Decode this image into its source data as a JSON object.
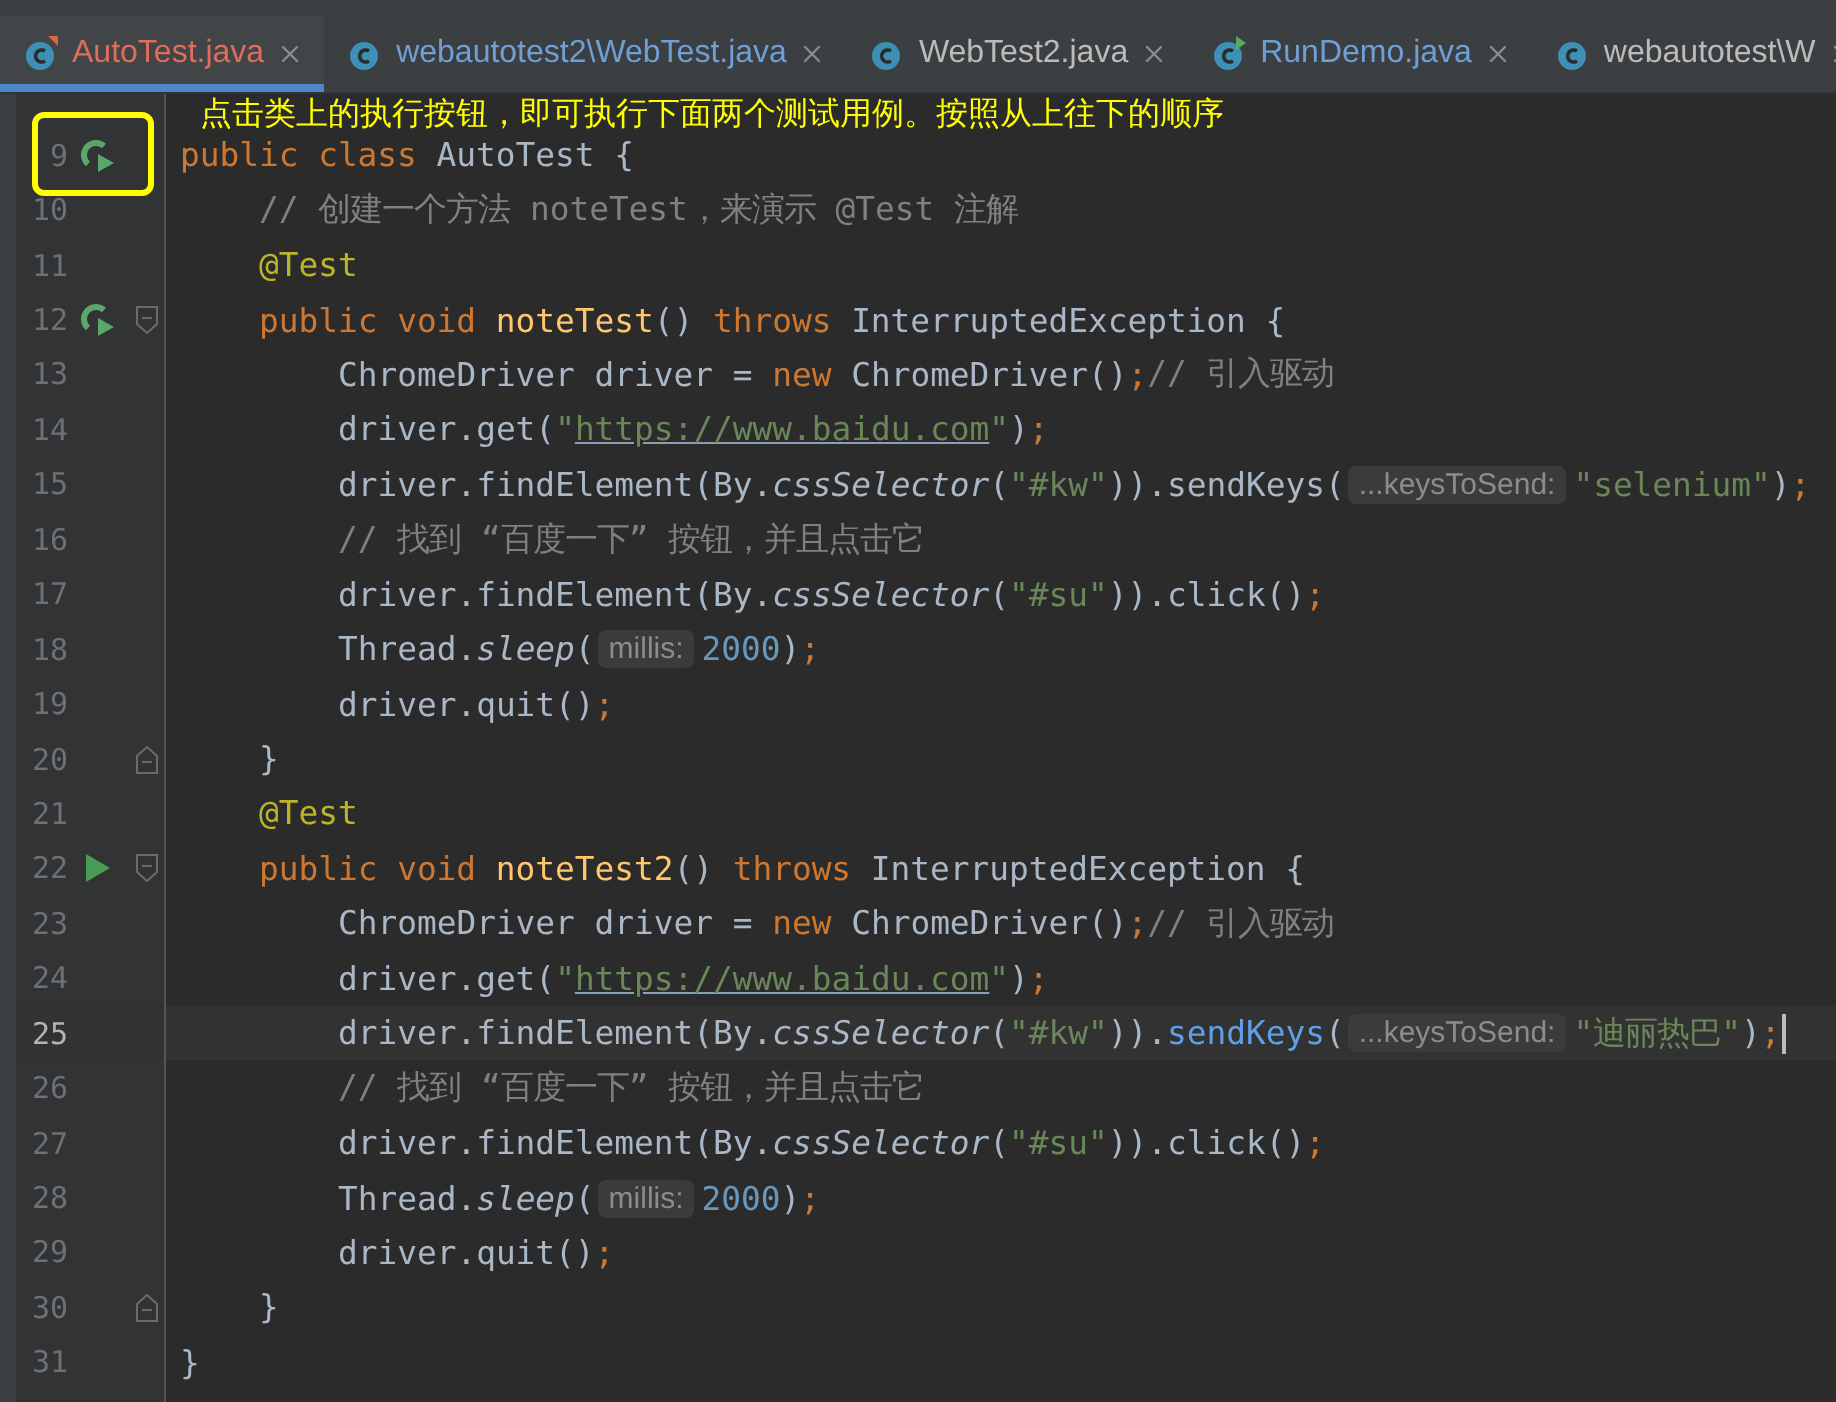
{
  "tabs": [
    {
      "label": "AutoTest.java",
      "color": "#e06c5a",
      "kind": "test",
      "selected": true
    },
    {
      "label": "webautotest2\\WebTest.java",
      "color": "#6e9fd6",
      "kind": "class",
      "selected": false
    },
    {
      "label": "WebTest2.java",
      "color": "#bbbbbb",
      "kind": "class",
      "selected": false
    },
    {
      "label": "RunDemo.java",
      "color": "#6e9fd6",
      "kind": "run",
      "selected": false
    },
    {
      "label": "webautotest\\W",
      "color": "#bbbbbb",
      "kind": "class",
      "selected": false
    }
  ],
  "annotation": "点击类上的执行按钮，即可执行下面两个测试用例。按照从上往下的顺序",
  "lines": [
    {
      "number": "9",
      "kind": "rerun",
      "fold_start": false,
      "fold_end": false,
      "current": false,
      "tokens": [
        {
          "kind": "kw",
          "text": "public class "
        },
        {
          "kind": "plain",
          "text": "AutoTest {"
        }
      ],
      "children": [
        {
          "number": "10",
          "kind": "code",
          "fold_start": false,
          "fold_end": false,
          "current": false,
          "tokens": [
            {
              "kind": "comment",
              "text": "// 创建一个方法 noteTest，来演示 @Test 注解"
            }
          ]
        },
        {
          "number": "11",
          "kind": "code",
          "fold_start": false,
          "fold_end": false,
          "current": false,
          "tokens": [
            {
              "kind": "anno",
              "text": "@Test"
            }
          ]
        },
        {
          "number": "12",
          "kind": "rerun",
          "fold_start": true,
          "fold_end": false,
          "current": false,
          "tokens": [
            {
              "kind": "kw",
              "text": "public void "
            },
            {
              "kind": "decl",
              "text": "noteTest"
            },
            {
              "kind": "plain",
              "text": "() "
            },
            {
              "kind": "kw",
              "text": "throws "
            },
            {
              "kind": "plain",
              "text": "InterruptedException {"
            }
          ],
          "children": [
            {
              "number": "13",
              "kind": "code",
              "fold_start": false,
              "fold_end": false,
              "current": false,
              "tokens": [
                {
                  "kind": "plain",
                  "text": "ChromeDriver driver = "
                },
                {
                  "kind": "kw",
                  "text": "new "
                },
                {
                  "kind": "plain",
                  "text": "ChromeDriver()"
                },
                {
                  "kind": "kw",
                  "text": ";"
                },
                {
                  "kind": "comment",
                  "text": "// 引入驱动"
                }
              ]
            },
            {
              "number": "14",
              "kind": "code",
              "fold_start": false,
              "fold_end": false,
              "current": false,
              "tokens": [
                {
                  "kind": "plain",
                  "text": "driver.get("
                },
                {
                  "kind": "str",
                  "text": "\""
                },
                {
                  "kind": "url",
                  "text": "https://www.baidu.com"
                },
                {
                  "kind": "str",
                  "text": "\""
                },
                {
                  "kind": "plain",
                  "text": ")"
                },
                {
                  "kind": "kw",
                  "text": ";"
                }
              ]
            },
            {
              "number": "15",
              "kind": "code",
              "fold_start": false,
              "fold_end": false,
              "current": false,
              "tokens": [
                {
                  "kind": "plain",
                  "text": "driver.findElement(By."
                },
                {
                  "kind": "static",
                  "text": "cssSelector"
                },
                {
                  "kind": "plain",
                  "text": "("
                },
                {
                  "kind": "str",
                  "text": "\"#kw\""
                },
                {
                  "kind": "plain",
                  "text": ")).sendKeys("
                },
                {
                  "kind": "hint",
                  "text": "...keysToSend:"
                },
                {
                  "kind": "str",
                  "text": "\"selenium\""
                },
                {
                  "kind": "plain",
                  "text": ")"
                },
                {
                  "kind": "kw",
                  "text": ";"
                }
              ]
            },
            {
              "number": "16",
              "kind": "code",
              "fold_start": false,
              "fold_end": false,
              "current": false,
              "tokens": [
                {
                  "kind": "comment",
                  "text": "// 找到 “百度一下” 按钮，并且点击它"
                }
              ]
            },
            {
              "number": "17",
              "kind": "code",
              "fold_start": false,
              "fold_end": false,
              "current": false,
              "tokens": [
                {
                  "kind": "plain",
                  "text": "driver.findElement(By."
                },
                {
                  "kind": "static",
                  "text": "cssSelector"
                },
                {
                  "kind": "plain",
                  "text": "("
                },
                {
                  "kind": "str",
                  "text": "\"#su\""
                },
                {
                  "kind": "plain",
                  "text": ")).click()"
                },
                {
                  "kind": "kw",
                  "text": ";"
                }
              ]
            },
            {
              "number": "18",
              "kind": "code",
              "fold_start": false,
              "fold_end": false,
              "current": false,
              "tokens": [
                {
                  "kind": "plain",
                  "text": "Thread."
                },
                {
                  "kind": "static",
                  "text": "sleep"
                },
                {
                  "kind": "plain",
                  "text": "("
                },
                {
                  "kind": "hint",
                  "text": "millis:"
                },
                {
                  "kind": "num",
                  "text": "2000"
                },
                {
                  "kind": "plain",
                  "text": ")"
                },
                {
                  "kind": "kw",
                  "text": ";"
                }
              ]
            },
            {
              "number": "19",
              "kind": "code",
              "fold_start": false,
              "fold_end": false,
              "current": false,
              "tokens": [
                {
                  "kind": "plain",
                  "text": "driver.quit()"
                },
                {
                  "kind": "kw",
                  "text": ";"
                }
              ]
            }
          ]
        },
        {
          "number": "20",
          "kind": "code",
          "fold_start": false,
          "fold_end": true,
          "current": false,
          "tokens": [
            {
              "kind": "plain",
              "text": "}"
            }
          ]
        },
        {
          "number": "21",
          "kind": "code",
          "fold_start": false,
          "fold_end": false,
          "current": false,
          "tokens": [
            {
              "kind": "anno",
              "text": "@Test"
            }
          ]
        },
        {
          "number": "22",
          "kind": "run",
          "fold_start": true,
          "fold_end": false,
          "current": false,
          "tokens": [
            {
              "kind": "kw",
              "text": "public void "
            },
            {
              "kind": "decl",
              "text": "noteTest2"
            },
            {
              "kind": "plain",
              "text": "() "
            },
            {
              "kind": "kw",
              "text": "throws "
            },
            {
              "kind": "plain",
              "text": "InterruptedException {"
            }
          ],
          "children": [
            {
              "number": "23",
              "kind": "code",
              "fold_start": false,
              "fold_end": false,
              "current": false,
              "tokens": [
                {
                  "kind": "plain",
                  "text": "ChromeDriver driver = "
                },
                {
                  "kind": "kw",
                  "text": "new "
                },
                {
                  "kind": "plain",
                  "text": "ChromeDriver()"
                },
                {
                  "kind": "kw",
                  "text": ";"
                },
                {
                  "kind": "comment",
                  "text": "// 引入驱动"
                }
              ]
            },
            {
              "number": "24",
              "kind": "code",
              "fold_start": false,
              "fold_end": false,
              "current": false,
              "tokens": [
                {
                  "kind": "plain",
                  "text": "driver.get("
                },
                {
                  "kind": "str",
                  "text": "\""
                },
                {
                  "kind": "url",
                  "text": "https://www.baidu.com"
                },
                {
                  "kind": "str",
                  "text": "\""
                },
                {
                  "kind": "plain",
                  "text": ")"
                },
                {
                  "kind": "kw",
                  "text": ";"
                }
              ]
            },
            {
              "number": "25",
              "kind": "code",
              "fold_start": false,
              "fold_end": false,
              "current": true,
              "tokens": [
                {
                  "kind": "plain",
                  "text": "driver.findElement(By."
                },
                {
                  "kind": "static",
                  "text": "cssSelector"
                },
                {
                  "kind": "plain",
                  "text": "("
                },
                {
                  "kind": "str",
                  "text": "\"#kw\""
                },
                {
                  "kind": "plain",
                  "text": "))."
                },
                {
                  "kind": "ref",
                  "text": "sendKeys"
                },
                {
                  "kind": "plain",
                  "text": "("
                },
                {
                  "kind": "hint",
                  "text": "...keysToSend:"
                },
                {
                  "kind": "str",
                  "text": "\"迪丽热巴\""
                },
                {
                  "kind": "plain",
                  "text": ")"
                },
                {
                  "kind": "kw",
                  "text": ";"
                }
              ]
            },
            {
              "number": "26",
              "kind": "code",
              "fold_start": false,
              "fold_end": false,
              "current": false,
              "tokens": [
                {
                  "kind": "comment",
                  "text": "// 找到 “百度一下” 按钮，并且点击它"
                }
              ]
            },
            {
              "number": "27",
              "kind": "code",
              "fold_start": false,
              "fold_end": false,
              "current": false,
              "tokens": [
                {
                  "kind": "plain",
                  "text": "driver.findElement(By."
                },
                {
                  "kind": "static",
                  "text": "cssSelector"
                },
                {
                  "kind": "plain",
                  "text": "("
                },
                {
                  "kind": "str",
                  "text": "\"#su\""
                },
                {
                  "kind": "plain",
                  "text": ")).click()"
                },
                {
                  "kind": "kw",
                  "text": ";"
                }
              ]
            },
            {
              "number": "28",
              "kind": "code",
              "fold_start": false,
              "fold_end": false,
              "current": false,
              "tokens": [
                {
                  "kind": "plain",
                  "text": "Thread."
                },
                {
                  "kind": "static",
                  "text": "sleep"
                },
                {
                  "kind": "plain",
                  "text": "("
                },
                {
                  "kind": "hint",
                  "text": "millis:"
                },
                {
                  "kind": "num",
                  "text": "2000"
                },
                {
                  "kind": "plain",
                  "text": ")"
                },
                {
                  "kind": "kw",
                  "text": ";"
                }
              ]
            },
            {
              "number": "29",
              "kind": "code",
              "fold_start": false,
              "fold_end": false,
              "current": false,
              "tokens": [
                {
                  "kind": "plain",
                  "text": "driver.quit()"
                },
                {
                  "kind": "kw",
                  "text": ";"
                }
              ]
            }
          ]
        },
        {
          "number": "30",
          "kind": "code",
          "fold_start": false,
          "fold_end": true,
          "current": false,
          "tokens": [
            {
              "kind": "plain",
              "text": "}"
            }
          ]
        }
      ]
    },
    {
      "number": "31",
      "kind": "code",
      "fold_start": false,
      "fold_end": false,
      "current": false,
      "tokens": [
        {
          "kind": "plain",
          "text": "}"
        }
      ]
    }
  ]
}
